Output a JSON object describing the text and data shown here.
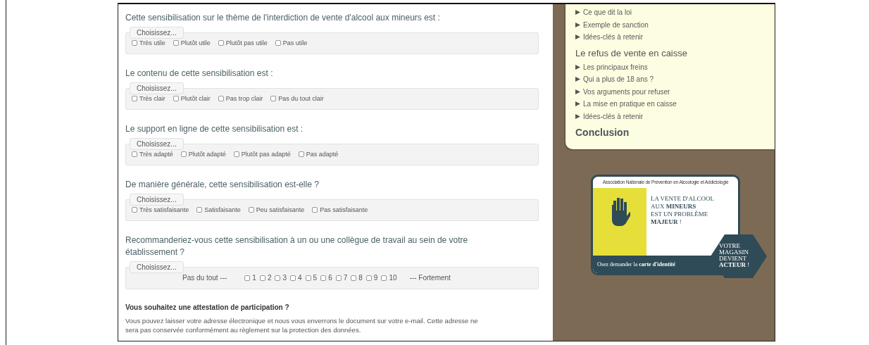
{
  "questions": [
    {
      "kind": "choices",
      "text": "Cette sensibilisation sur le thème de l'interdiction de vente d'alcool aux mineurs est :",
      "legend": "Choisissez...",
      "options": [
        {
          "label": "Très utile",
          "checked": false
        },
        {
          "label": "Plutôt utile",
          "checked": false
        },
        {
          "label": "Plutôt pas utile",
          "checked": false
        },
        {
          "label": "Pas utile",
          "checked": false
        }
      ]
    },
    {
      "kind": "choices",
      "text": "Le contenu de cette sensibilisation est :",
      "legend": "Choisissez...",
      "options": [
        {
          "label": "Très clair",
          "checked": false
        },
        {
          "label": "Plutôt clair",
          "checked": false
        },
        {
          "label": "Pas trop clair",
          "checked": false
        },
        {
          "label": "Pas du tout clair",
          "checked": false
        }
      ]
    },
    {
      "kind": "choices",
      "text": "Le support en ligne de cette sensibilisation est :",
      "legend": "Choisissez...",
      "options": [
        {
          "label": "Très adapté",
          "checked": false
        },
        {
          "label": "Plutôt adapté",
          "checked": false
        },
        {
          "label": "Plutôt pas adapté",
          "checked": false
        },
        {
          "label": "Pas adapté",
          "checked": false
        }
      ]
    },
    {
      "kind": "choices",
      "text": "De manière générale, cette sensibilisation est-elle ?",
      "legend": "Choisissez...",
      "options": [
        {
          "label": "Très satisfaisante",
          "checked": false
        },
        {
          "label": "Satisfaisante",
          "checked": false
        },
        {
          "label": "Peu satisfaisante",
          "checked": false
        },
        {
          "label": "Pas satisfaisante",
          "checked": false
        }
      ]
    },
    {
      "kind": "scale",
      "text": "Recommanderiez-vous cette sensibilisation à un ou une collègue de travail au sein de votre établissement ?",
      "legend": "Choisissez...",
      "low_label": "Pas du tout ---",
      "high_label": "--- Fortement",
      "options": [
        {
          "label": "1",
          "checked": false
        },
        {
          "label": "2",
          "checked": false
        },
        {
          "label": "3",
          "checked": false
        },
        {
          "label": "4",
          "checked": false
        },
        {
          "label": "5",
          "checked": false
        },
        {
          "label": "6",
          "checked": false
        },
        {
          "label": "7",
          "checked": false
        },
        {
          "label": "8",
          "checked": false
        },
        {
          "label": "9",
          "checked": false
        },
        {
          "label": "10",
          "checked": false
        }
      ]
    }
  ],
  "attestation": {
    "title": "Vous souhaitez une attestation de participation ?",
    "text": "Vous pouvez laisser votre adresse électronique et nous vous enverrons le document sur votre e-mail. Cette adresse ne sera pas conservée conformément au règlement sur la protection des données."
  },
  "sidebar": {
    "sections": [
      {
        "kind": "topic",
        "items": [
          "Ce que dit la loi",
          "Exemple de sanction",
          "Idées-clés à retenir"
        ]
      },
      {
        "kind": "topic",
        "heading": "Le refus de vente en caisse",
        "items": [
          "Les principaux freins",
          "Qui a plus de 18 ans ?",
          "Vos arguments pour refuser",
          "La mise en pratique en caisse",
          "Idées-clés à retenir"
        ]
      },
      {
        "kind": "chapter",
        "heading": "Conclusion"
      }
    ]
  },
  "banner": {
    "header": "Association Nationale de Prévention en Alcoologie et Addictologie",
    "message": [
      "LA VENTE D'ALCOOL",
      "AUX **MINEURS**",
      "EST UN PROBLÈME",
      "**MAJEUR** !"
    ],
    "footer": "Osez demander la **carte d'identité**",
    "seal": [
      "VOTRE",
      "MAGASIN",
      "DEVIENT",
      "**ACTEUR** !"
    ]
  }
}
